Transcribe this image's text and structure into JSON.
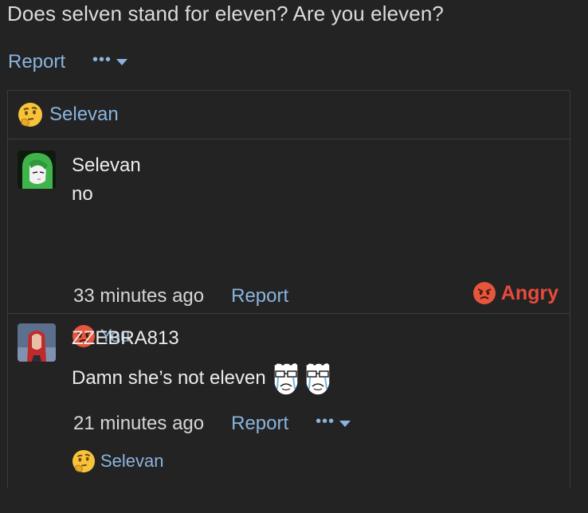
{
  "question": "Does selven stand for eleven? Are you eleven?",
  "top_actions": {
    "report_label": "Report",
    "more_label": "•••"
  },
  "reaction_header": {
    "icon": "thinking-face-icon",
    "user": "Selevan"
  },
  "comments": [
    {
      "author": "Selevan",
      "avatar": "green-hair-anime-avatar",
      "text": "no",
      "time": "33 minutes ago",
      "report_label": "Report",
      "reaction_label": "Angry",
      "reaction_icon": "angry-face-icon",
      "reacted_by": "You"
    },
    {
      "author": "ZZEBRA813",
      "avatar": "red-hair-avatar",
      "text": "Damn she’s not eleven",
      "stickers": [
        "crying-rage-face-sticker",
        "crying-rage-face-sticker"
      ],
      "time": "21 minutes ago",
      "report_label": "Report",
      "more_label": "•••",
      "reacted_by": "Selevan",
      "reaction_icon": "thinking-face-icon"
    }
  ],
  "colors": {
    "link": "#8ab4df",
    "angry": "#e84a3c",
    "background": "#232323",
    "border": "#3b3b3b"
  }
}
